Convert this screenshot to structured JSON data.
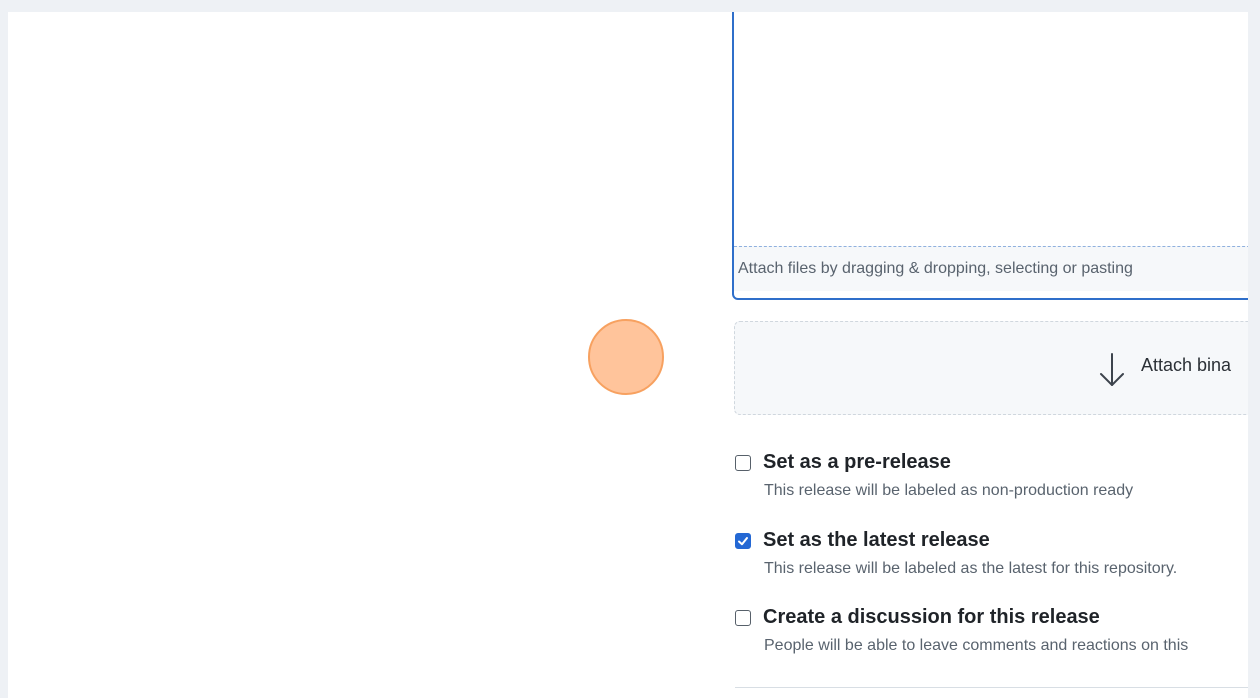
{
  "editor": {
    "footer_hint": "Attach files by dragging & dropping, selecting or pasting"
  },
  "attach_binaries": {
    "label": "Attach bina",
    "icon": "arrow-down-icon"
  },
  "options": [
    {
      "title": "Set as a pre-release",
      "description": "This release will be labeled as non-production ready",
      "checked": false
    },
    {
      "title": "Set as the latest release",
      "description": "This release will be labeled as the latest for this repository.",
      "checked": true
    },
    {
      "title": "Create a discussion for this release",
      "description": "People will be able to leave comments and reactions on this",
      "checked": false
    }
  ],
  "colors": {
    "accent": "#2468d4",
    "click_indicator": "#ffc49b"
  }
}
